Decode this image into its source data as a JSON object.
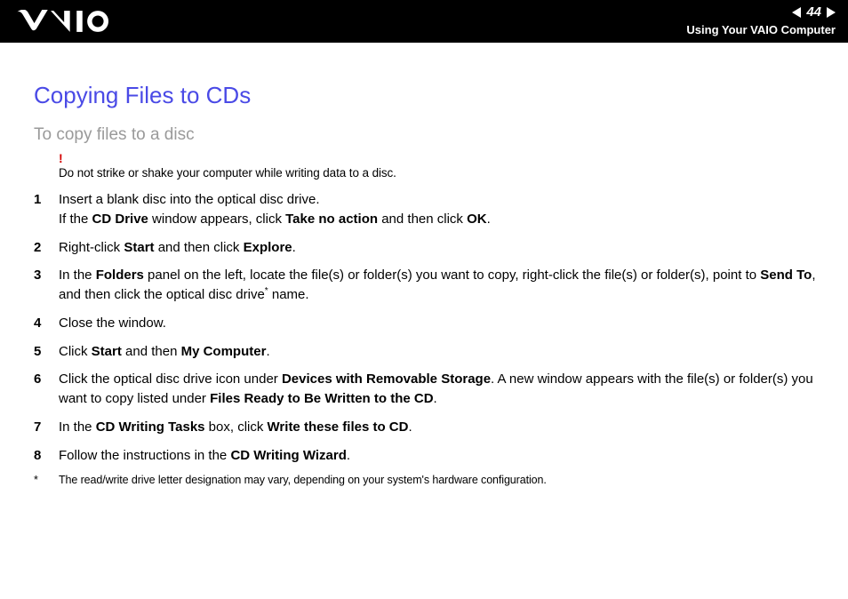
{
  "header": {
    "page_number": "44",
    "section": "Using Your VAIO Computer"
  },
  "title": "Copying Files to CDs",
  "subtitle": "To copy files to a disc",
  "warning": {
    "mark": "!",
    "text": "Do not strike or shake your computer while writing data to a disc."
  },
  "steps": [
    {
      "n": "1",
      "runs": [
        {
          "t": "Insert a blank disc into the optical disc drive."
        },
        {
          "br": true
        },
        {
          "t": "If the "
        },
        {
          "t": "CD Drive",
          "b": true
        },
        {
          "t": " window appears, click "
        },
        {
          "t": "Take no action",
          "b": true
        },
        {
          "t": " and then click "
        },
        {
          "t": "OK",
          "b": true
        },
        {
          "t": "."
        }
      ]
    },
    {
      "n": "2",
      "runs": [
        {
          "t": "Right-click "
        },
        {
          "t": "Start",
          "b": true
        },
        {
          "t": " and then click "
        },
        {
          "t": "Explore",
          "b": true
        },
        {
          "t": "."
        }
      ]
    },
    {
      "n": "3",
      "runs": [
        {
          "t": "In the "
        },
        {
          "t": "Folders",
          "b": true
        },
        {
          "t": " panel on the left, locate the file(s) or folder(s) you want to copy, right-click the file(s) or folder(s), point to "
        },
        {
          "t": "Send To",
          "b": true
        },
        {
          "t": ", and then click the optical disc drive"
        },
        {
          "t": "*",
          "sup": true
        },
        {
          "t": " name."
        }
      ]
    },
    {
      "n": "4",
      "runs": [
        {
          "t": "Close the window."
        }
      ]
    },
    {
      "n": "5",
      "runs": [
        {
          "t": "Click "
        },
        {
          "t": "Start",
          "b": true
        },
        {
          "t": " and then "
        },
        {
          "t": "My Computer",
          "b": true
        },
        {
          "t": "."
        }
      ]
    },
    {
      "n": "6",
      "runs": [
        {
          "t": "Click the optical disc drive icon under "
        },
        {
          "t": "Devices with Removable Storage",
          "b": true
        },
        {
          "t": ". A new window appears with the file(s) or folder(s) you want to copy listed under "
        },
        {
          "t": "Files Ready to Be Written to the CD",
          "b": true
        },
        {
          "t": "."
        }
      ]
    },
    {
      "n": "7",
      "runs": [
        {
          "t": "In the "
        },
        {
          "t": "CD Writing Tasks",
          "b": true
        },
        {
          "t": " box, click "
        },
        {
          "t": "Write these files to CD",
          "b": true
        },
        {
          "t": "."
        }
      ]
    },
    {
      "n": "8",
      "runs": [
        {
          "t": "Follow the instructions in the "
        },
        {
          "t": "CD Writing Wizard",
          "b": true
        },
        {
          "t": "."
        }
      ]
    }
  ],
  "footnote": {
    "mark": "*",
    "text": "The read/write drive letter designation may vary, depending on your system's hardware configuration."
  }
}
